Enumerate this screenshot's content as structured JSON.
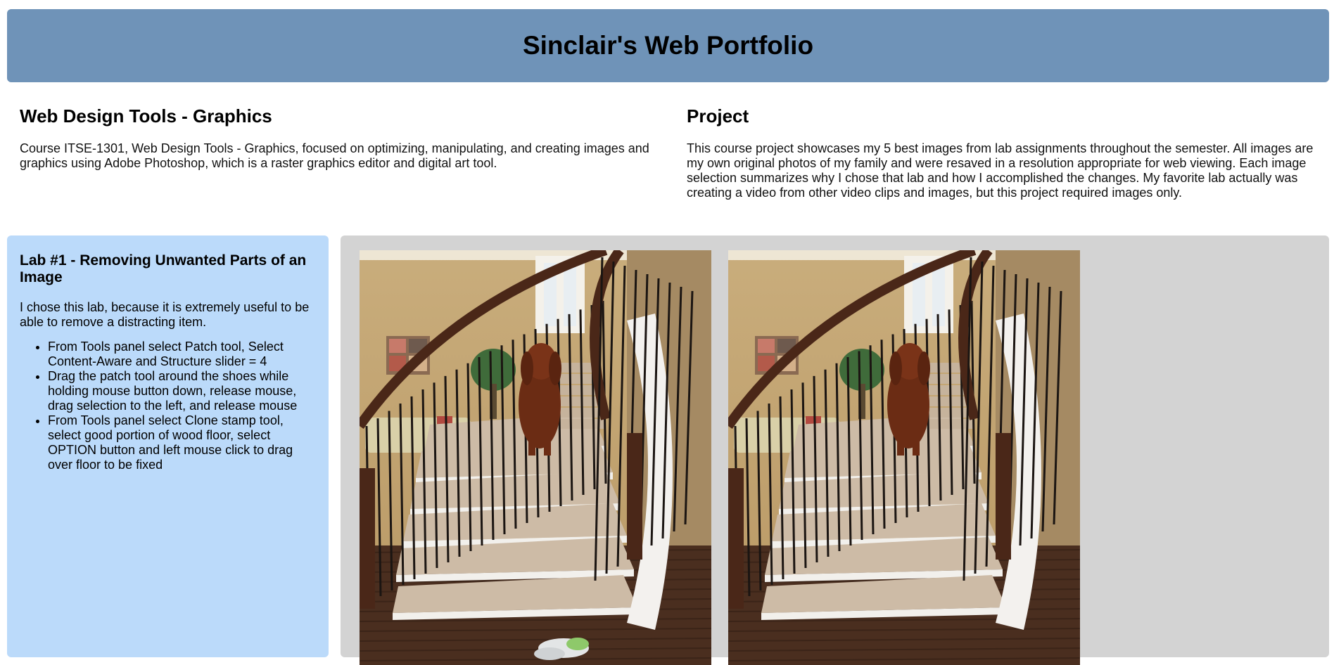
{
  "header": {
    "title": "Sinclair's Web Portfolio"
  },
  "intro": {
    "left": {
      "heading": "Web Design Tools - Graphics",
      "text": "Course ITSE-1301, Web Design Tools - Graphics, focused on optimizing, manipulating, and creating images and graphics using Adobe Photoshop, which is a raster graphics editor and digital art tool."
    },
    "right": {
      "heading": "Project",
      "text": "This course project showcases my 5 best images from lab assignments throughout the semester. All images are my own original photos of my family and were resaved in a resolution appropriate for web viewing. Each image selection summarizes why I chose that lab and how I accomplished the changes. My favorite lab actually was creating a video from other video clips and images, but this project required images only."
    }
  },
  "lab": {
    "title": "Lab #1 - Removing Unwanted Parts of an Image",
    "reason": "I chose this lab, because it is extremely useful to be able to remove a distracting item.",
    "steps": [
      "From Tools panel select Patch tool, Select Content-Aware and Structure slider = 4",
      "Drag the patch tool around the shoes while holding mouse button down, release mouse, drag selection to the left, and release mouse",
      "From Tools panel select Clone stamp tool, select good portion of wood floor, select OPTION button and left mouse click to drag over floor to be fixed"
    ]
  },
  "gallery": {
    "images": [
      {
        "name": "before-photo",
        "description": "staircase with dog and shoes"
      },
      {
        "name": "after-photo",
        "description": "staircase with dog, shoes removed"
      }
    ]
  }
}
